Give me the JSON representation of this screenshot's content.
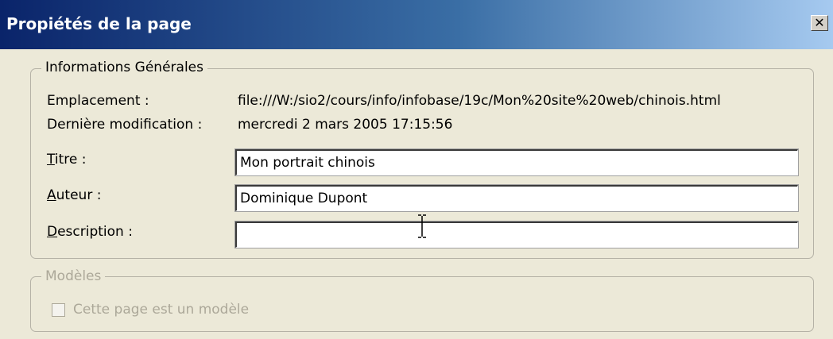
{
  "window": {
    "title": "Propiétés de la page",
    "close_symbol": "✕"
  },
  "general": {
    "legend": "Informations Générales",
    "location_label": "Emplacement :",
    "location_value": "file:///W:/sio2/cours/info/infobase/19c/Mon%20site%20web/chinois.html",
    "modified_label": "Dernière modification :",
    "modified_value": "mercredi 2 mars 2005 17:15:56",
    "title_label_mnemonic": "T",
    "title_label_rest": "itre :",
    "title_value": "Mon portrait chinois",
    "author_label_mnemonic": "A",
    "author_label_rest": "uteur :",
    "author_value": "Dominique Dupont",
    "description_label_mnemonic": "D",
    "description_label_rest": "escription :",
    "description_value": ""
  },
  "templates": {
    "legend": "Modèles",
    "checkbox_label": "Cette page est un modèle",
    "checked": false
  }
}
